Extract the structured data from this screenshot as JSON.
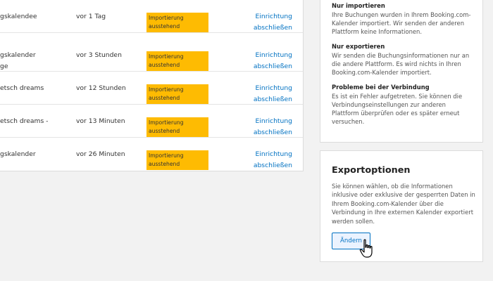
{
  "table": {
    "rows": [
      {
        "name": "gskalendee",
        "time": "vor 1 Tag",
        "status": "Importierung\nausstehend",
        "action": "Einrichtung\nabschließen"
      },
      {
        "name": "gskalender\nge",
        "time": "vor 3 Stunden",
        "status": "Importierung\nausstehend",
        "action": "Einrichtung\nabschließen"
      },
      {
        "name": "etsch dreams",
        "time": "vor 12 Stunden",
        "status": "Importierung\nausstehend",
        "action": "Einrichtung\nabschließen"
      },
      {
        "name": "etsch dreams -",
        "time": "vor 13 Minuten",
        "status": "Importierung\nausstehend",
        "action": "Einrichtung\nabschließen"
      },
      {
        "name": "gskalender",
        "time": "vor 26 Minuten",
        "status": "Importierung\nausstehend",
        "action": "Einrichtung\nabschließen"
      }
    ]
  },
  "info": {
    "import_only": {
      "heading": "Nur importieren",
      "text": "Ihre Buchungen wurden in Ihrem Booking.com-\nKalender importiert. Wir senden der anderen\nPlattform keine Informationen."
    },
    "export_only": {
      "heading": "Nur exportieren",
      "text": "Wir senden die Buchungsinformationen nur an\ndie andere Plattform. Es wird nichts in Ihren\nBooking.com-Kalender importiert."
    },
    "connection_problems": {
      "heading": "Probleme bei der Verbindung",
      "text": "Es ist ein Fehler aufgetreten. Sie können die\nVerbindungseinstellungen zur anderen\nPlattform überprüfen oder es später erneut\nversuchen."
    }
  },
  "export": {
    "title": "Exportoptionen",
    "text": "Sie können wählen, ob die Informationen\ninklusive oder exklusive der gesperrten Daten in\nIhrem Booking.com-Kalender über die\nVerbindung in Ihre externen Kalender exportiert\nwerden sollen.",
    "button_label": "Ändern"
  },
  "icons": {
    "cursor": "hand-pointer-icon"
  },
  "colors": {
    "badge": "#febb02",
    "link": "#0071c2",
    "background": "#f2f2f2"
  }
}
